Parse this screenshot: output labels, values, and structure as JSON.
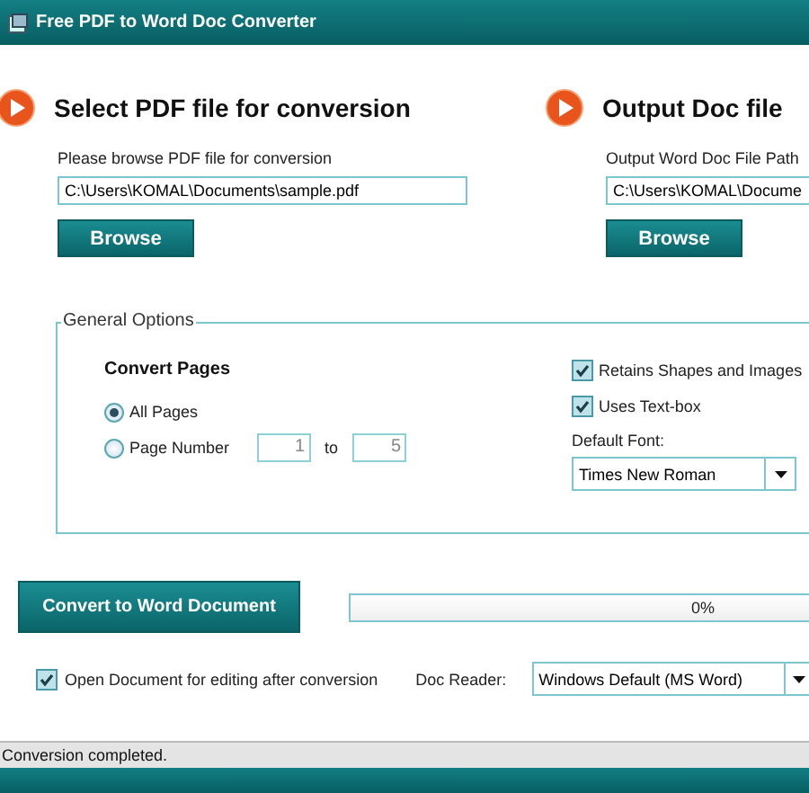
{
  "window": {
    "title": "Free PDF to Word Doc Converter"
  },
  "input_section": {
    "heading": "Select PDF file for conversion",
    "label": "Please browse PDF file for conversion",
    "path": "C:\\Users\\KOMAL\\Documents\\sample.pdf",
    "button": "Browse"
  },
  "output_section": {
    "heading": "Output Doc file",
    "label": "Output Word Doc File Path",
    "path": "C:\\Users\\KOMAL\\Docume",
    "button": "Browse"
  },
  "general_options": {
    "legend": "General Options",
    "convert_pages": {
      "heading": "Convert Pages",
      "options": [
        {
          "label": "All Pages",
          "selected": true
        },
        {
          "label": "Page Number",
          "selected": false
        }
      ],
      "range": {
        "from": "1",
        "separator": "to",
        "to": "5",
        "disabled": true
      }
    },
    "checkboxes": [
      {
        "label": "Retains Shapes and Images",
        "checked": true
      },
      {
        "label": "Uses Text-box",
        "checked": true
      }
    ],
    "default_font": {
      "label": "Default Font:",
      "value": "Times New Roman"
    }
  },
  "convert_button": "Convert to Word Document",
  "progress": {
    "level": 0,
    "reading": "0%"
  },
  "open_after": {
    "label": "Open Document for editing after conversion",
    "checked": true
  },
  "doc_reader": {
    "label": "Doc Reader:",
    "value": "Windows Default (MS Word)"
  },
  "status_bar": "Conversion completed."
}
